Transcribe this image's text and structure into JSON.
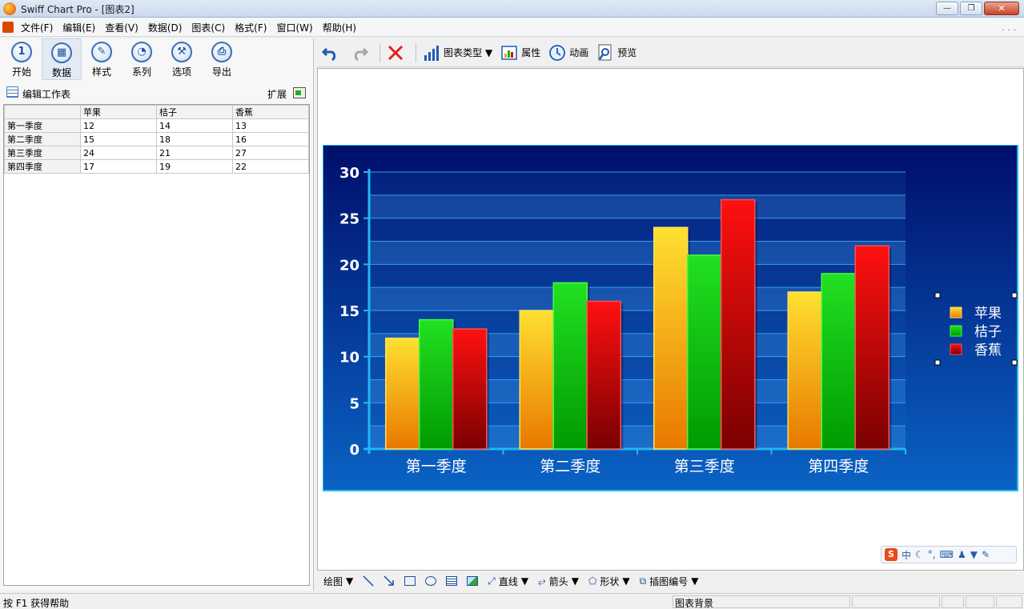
{
  "window": {
    "title": "Swiff Chart Pro - [图表2]",
    "min": "—",
    "max": "❐",
    "close": "✕"
  },
  "menu": [
    "文件(F)",
    "编辑(E)",
    "查看(V)",
    "数据(D)",
    "图表(C)",
    "格式(F)",
    "窗口(W)",
    "帮助(H)"
  ],
  "tabs": [
    {
      "label": "开始",
      "icon": "1"
    },
    {
      "label": "数据",
      "icon": "▦"
    },
    {
      "label": "样式",
      "icon": "✎"
    },
    {
      "label": "系列",
      "icon": "◔"
    },
    {
      "label": "选项",
      "icon": "⚒"
    },
    {
      "label": "导出",
      "icon": "⎙"
    }
  ],
  "worksheet": {
    "title": "编辑工作表",
    "expand": "扩展",
    "columns": [
      "",
      "苹果",
      "桔子",
      "香蕉"
    ],
    "rows": [
      [
        "第一季度",
        "12",
        "14",
        "13"
      ],
      [
        "第二季度",
        "15",
        "18",
        "16"
      ],
      [
        "第三季度",
        "24",
        "21",
        "27"
      ],
      [
        "第四季度",
        "17",
        "19",
        "22"
      ]
    ]
  },
  "toolbar": {
    "chart_type": "图表类型",
    "properties": "属性",
    "animation": "动画",
    "preview": "预览"
  },
  "draw_toolbar": {
    "draw": "绘图",
    "line": "直线",
    "arrow": "箭头",
    "shape": "形状",
    "insert": "插图编号"
  },
  "ime": {
    "mode": "中"
  },
  "status": {
    "help": "按 F1 获得帮助",
    "selection": "图表背景"
  },
  "colors": {
    "chart_bg_top": "#000e6b",
    "chart_bg_bottom": "#0a63c4",
    "apple": "#f7b81a",
    "orange": "#11c80f",
    "banana": "#e00000"
  },
  "chart_data": {
    "type": "bar",
    "categories": [
      "第一季度",
      "第二季度",
      "第三季度",
      "第四季度"
    ],
    "series": [
      {
        "name": "苹果",
        "values": [
          12,
          15,
          24,
          17
        ]
      },
      {
        "name": "桔子",
        "values": [
          14,
          18,
          21,
          19
        ]
      },
      {
        "name": "香蕉",
        "values": [
          13,
          16,
          27,
          22
        ]
      }
    ],
    "ylim": [
      0,
      30
    ],
    "yticks": [
      0,
      5,
      10,
      15,
      20,
      25,
      30
    ],
    "grid": true,
    "legend": "right"
  }
}
